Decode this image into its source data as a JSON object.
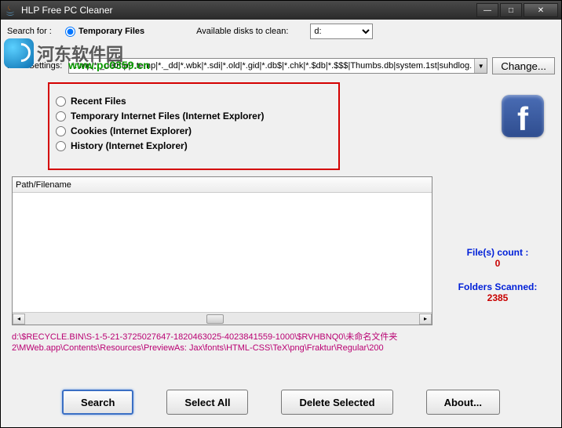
{
  "window": {
    "title": "HLP Free PC Cleaner"
  },
  "watermark": {
    "text_cn": "河东软件园",
    "url": "www.pc0359.cn"
  },
  "search_row": {
    "search_for_label": "Search for :",
    "temp_files_label": "Temporary Files",
    "avail_disks_label": "Available disks to clean:",
    "disk_selected": "d:"
  },
  "filter_row": {
    "label": "Filter Settings:",
    "value": "*.tmp|*._detmp|*.temp|*._dd|*.wbk|*.sdi|*.old|*.gid|*.db$|*.chk|*.$db|*.$$$|Thumbs.db|system.1st|suhdlog.",
    "change_btn": "Change..."
  },
  "options": [
    "Recent Files",
    "Temporary Internet Files (Internet Explorer)",
    "Cookies  (Internet Explorer)",
    "History  (Internet Explorer)"
  ],
  "table": {
    "header": "Path/Filename"
  },
  "stats": {
    "files_count_label": "File(s) count :",
    "files_count_value": "0",
    "folders_scanned_label": "Folders Scanned:",
    "folders_scanned_value": "2385"
  },
  "path_line1": "d:\\$RECYCLE.BIN\\S-1-5-21-3725027647-1820463025-4023841559-1000\\$RVHBNQ0\\未命名文件夹",
  "path_line2": "2\\MWeb.app\\Contents\\Resources\\PreviewAs:         Jax\\fonts\\HTML-CSS\\TeX\\png\\Fraktur\\Regular\\200",
  "buttons": {
    "search": "Search",
    "select_all": "Select All",
    "delete_selected": "Delete Selected",
    "about": "About..."
  }
}
